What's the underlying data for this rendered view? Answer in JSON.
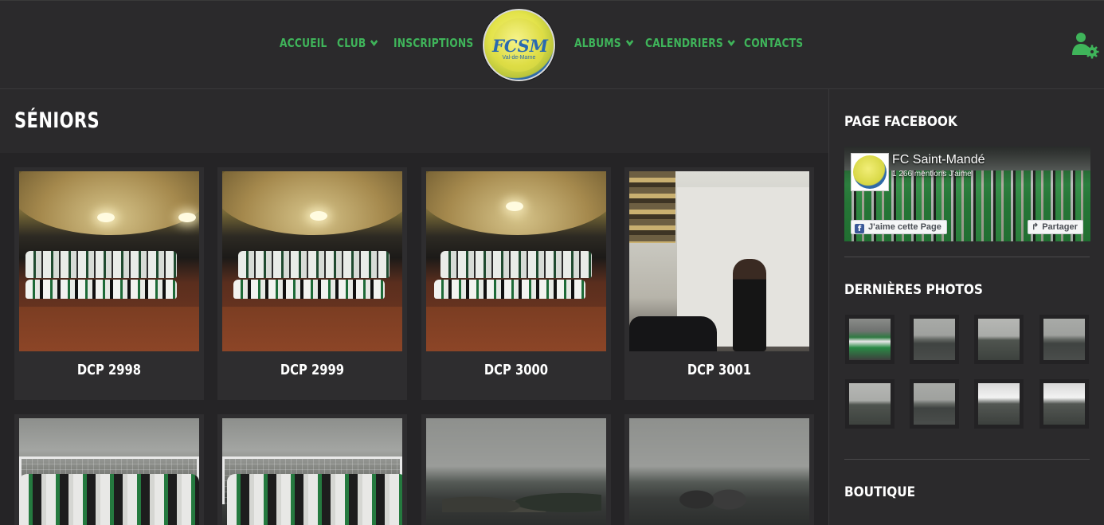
{
  "nav": {
    "items": [
      {
        "label": "ACCUEIL",
        "dropdown": false
      },
      {
        "label": "CLUB",
        "dropdown": true
      },
      {
        "label": "INSCRIPTIONS",
        "dropdown": false
      },
      {
        "label": "ALBUMS",
        "dropdown": true
      },
      {
        "label": "CALENDRIERS",
        "dropdown": true
      },
      {
        "label": "CONTACTS",
        "dropdown": false
      }
    ],
    "logo": {
      "text": "FCSM",
      "sub": "Val-de-Marne"
    },
    "accent": "#3fb45a"
  },
  "page": {
    "title": "SÉNIORS"
  },
  "gallery": {
    "photos": [
      {
        "caption": "DCP 2998"
      },
      {
        "caption": "DCP 2999"
      },
      {
        "caption": "DCP 3000"
      },
      {
        "caption": "DCP 3001"
      },
      {
        "caption": ""
      },
      {
        "caption": ""
      },
      {
        "caption": ""
      },
      {
        "caption": ""
      }
    ]
  },
  "sidebar": {
    "facebook": {
      "title": "PAGE FACEBOOK",
      "page_name": "FC Saint-Mandé",
      "likes": "1 266 mentions J'aime",
      "like_button": "J'aime cette Page",
      "share_button": "Partager"
    },
    "photos": {
      "title": "DERNIÈRES PHOTOS"
    },
    "shop": {
      "title": "BOUTIQUE"
    }
  },
  "icons": {
    "user": "user-gear-icon",
    "chevron": "chevron-down-icon",
    "facebook": "facebook-icon",
    "share": "share-arrow-icon"
  }
}
